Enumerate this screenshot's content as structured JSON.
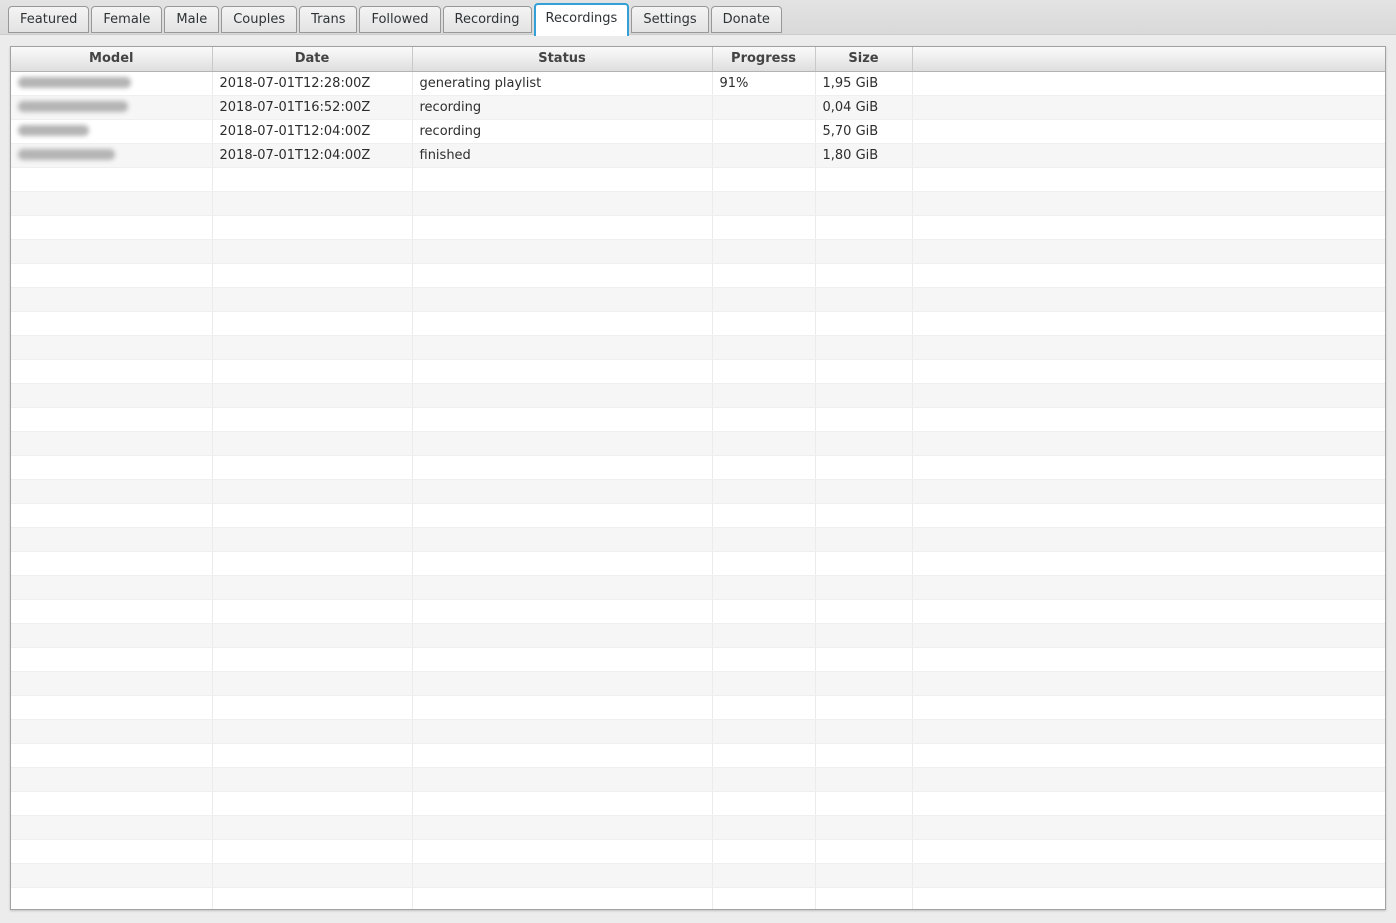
{
  "tabs": [
    {
      "label": "Featured",
      "active": false
    },
    {
      "label": "Female",
      "active": false
    },
    {
      "label": "Male",
      "active": false
    },
    {
      "label": "Couples",
      "active": false
    },
    {
      "label": "Trans",
      "active": false
    },
    {
      "label": "Followed",
      "active": false
    },
    {
      "label": "Recording",
      "active": false
    },
    {
      "label": "Recordings",
      "active": true
    },
    {
      "label": "Settings",
      "active": false
    },
    {
      "label": "Donate",
      "active": false
    }
  ],
  "table": {
    "columns": [
      {
        "label": "Model",
        "col_style": "width:201px"
      },
      {
        "label": "Date",
        "col_style": "width:200px"
      },
      {
        "label": "Status",
        "col_style": "width:300px"
      },
      {
        "label": "Progress",
        "col_style": "width:103px"
      },
      {
        "label": "Size",
        "col_style": "width:97px"
      },
      {
        "label": "",
        "col_style": "width:473px"
      }
    ],
    "rows": [
      {
        "model": "",
        "model_redacted": true,
        "model_blob_style": "width:113px",
        "date": "2018-07-01T12:28:00Z",
        "status": "generating playlist",
        "progress": "91%",
        "size": "1,95 GiB"
      },
      {
        "model": "",
        "model_redacted": true,
        "model_blob_style": "width:110px",
        "date": "2018-07-01T16:52:00Z",
        "status": "recording",
        "progress": "",
        "size": "0,04 GiB"
      },
      {
        "model": "",
        "model_redacted": true,
        "model_blob_style": "width:71px",
        "date": "2018-07-01T12:04:00Z",
        "status": "recording",
        "progress": "",
        "size": "5,70 GiB"
      },
      {
        "model": "",
        "model_redacted": true,
        "model_blob_style": "width:97px",
        "date": "2018-07-01T12:04:00Z",
        "status": "finished",
        "progress": "",
        "size": "1,80 GiB"
      }
    ],
    "empty_row_count": 31
  },
  "colors": {
    "active_tab_border": "#35a0d8",
    "window_background": "#ececec",
    "tab_band_background": "#dcdcdc",
    "row_stripe": "#f6f6f6",
    "table_border": "#a2a2a2"
  }
}
